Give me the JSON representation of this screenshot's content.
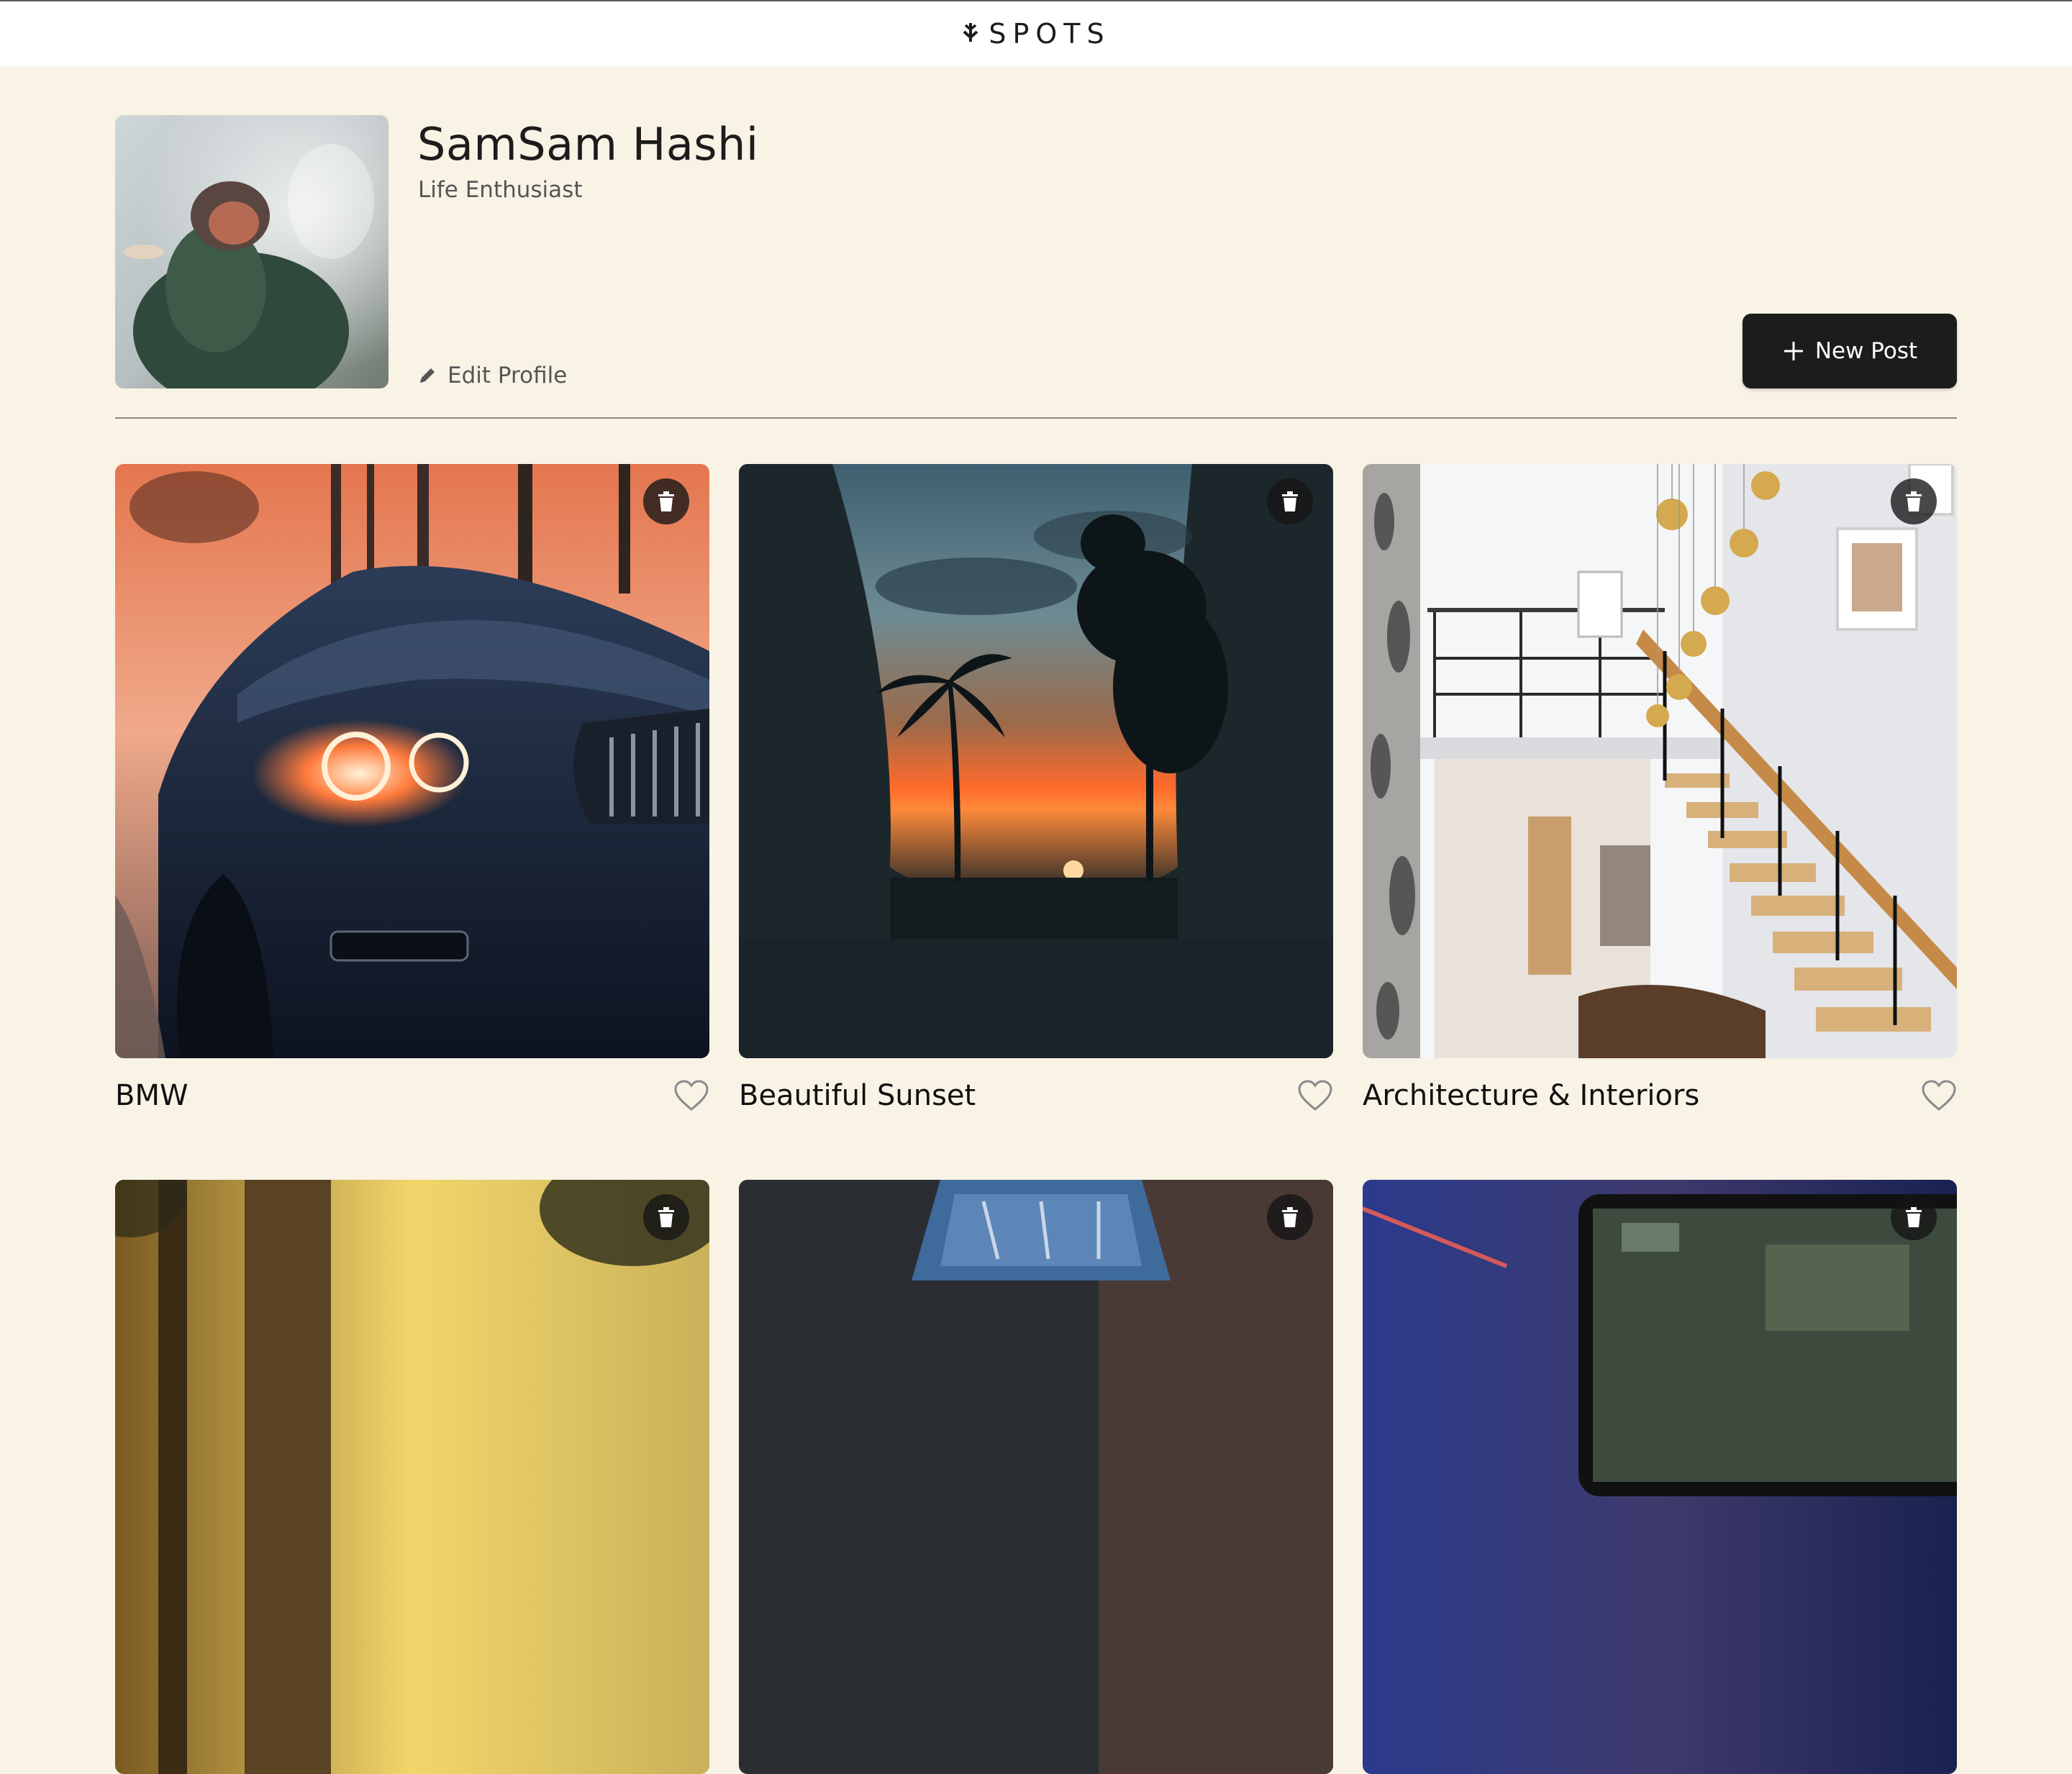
{
  "header": {
    "logo_text": "SPOTS",
    "logo_icon": "down-arrow-icon"
  },
  "profile": {
    "name": "SamSam Hashi",
    "tagline": "Life Enthusiast",
    "edit_label": "Edit Profile",
    "new_post_label": "New Post"
  },
  "cards": [
    {
      "title": "BMW",
      "liked": false
    },
    {
      "title": "Beautiful Sunset",
      "liked": false
    },
    {
      "title": "Architecture & Interiors",
      "liked": false
    },
    {
      "title": "",
      "liked": false
    },
    {
      "title": "",
      "liked": false
    },
    {
      "title": "",
      "liked": false
    }
  ],
  "colors": {
    "background": "#f9f3e6",
    "header": "#ffffff",
    "button": "#1c1c1c",
    "text": "#1c1c1c",
    "muted": "#555555"
  },
  "icons": [
    "pencil-icon",
    "plus-icon",
    "trash-icon",
    "heart-icon"
  ]
}
